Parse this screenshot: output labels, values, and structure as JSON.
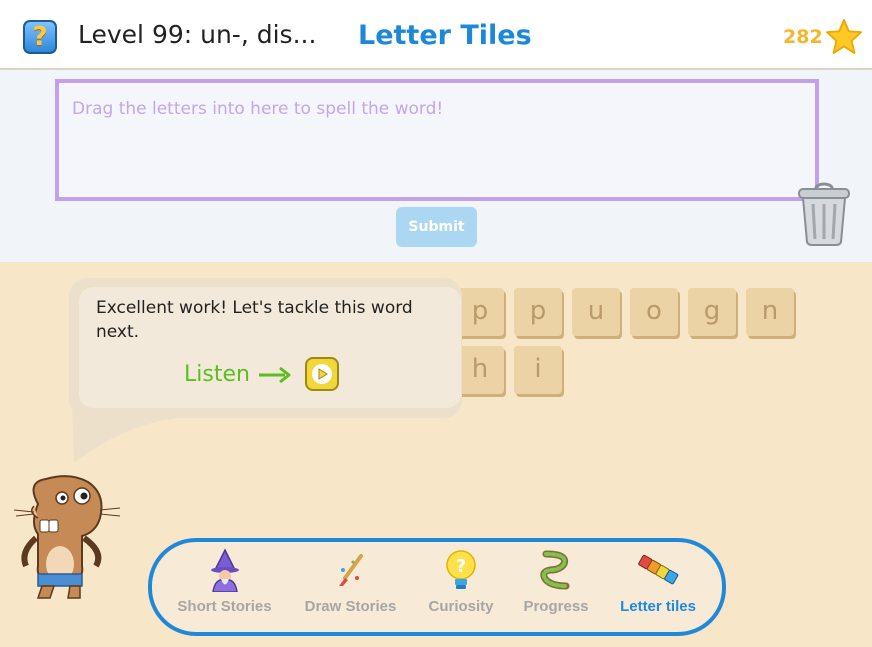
{
  "header": {
    "help_icon_glyph": "?",
    "level_title": "Level 99: un-, dis...",
    "app_title": "Letter Tiles",
    "score": "282"
  },
  "drop_zone": {
    "placeholder": "Drag the letters into here to spell the word!"
  },
  "submit_label": "Submit",
  "tiles": {
    "row1": [
      "p",
      "p",
      "u",
      "o",
      "g",
      "n"
    ],
    "row2": [
      "h",
      "i"
    ]
  },
  "speech": {
    "message": "Excellent work! Let's tackle this word next.",
    "listen_label": "Listen"
  },
  "nav": {
    "items": [
      {
        "label": "Short Stories",
        "icon": "wizard-icon"
      },
      {
        "label": "Draw Stories",
        "icon": "paintbrush-icon"
      },
      {
        "label": "Curiosity",
        "icon": "lightbulb-icon"
      },
      {
        "label": "Progress",
        "icon": "snake-path-icon"
      },
      {
        "label": "Letter tiles",
        "icon": "letter-tiles-icon"
      }
    ],
    "active_item": "Letter tiles"
  },
  "colors": {
    "accent_blue": "#1e88d8",
    "drop_zone_border": "#c2a1ea",
    "listen_green": "#5bbd20",
    "score_gold": "#f6b52a",
    "background_sand": "#f7e6c8"
  }
}
